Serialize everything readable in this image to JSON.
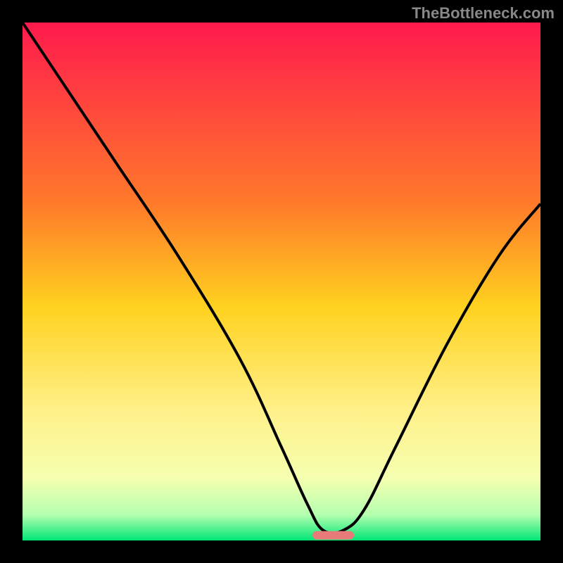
{
  "watermark": "TheBottleneck.com",
  "chart_data": {
    "type": "line",
    "title": "",
    "xlabel": "",
    "ylabel": "",
    "xlim": [
      0,
      100
    ],
    "ylim": [
      0,
      100
    ],
    "gradient_stops": [
      {
        "offset": 0,
        "color": "#ff1a4d"
      },
      {
        "offset": 35,
        "color": "#ff7a2a"
      },
      {
        "offset": 55,
        "color": "#ffd21f"
      },
      {
        "offset": 75,
        "color": "#fff08a"
      },
      {
        "offset": 88,
        "color": "#f5ffb0"
      },
      {
        "offset": 95,
        "color": "#b6ffb0"
      },
      {
        "offset": 100,
        "color": "#00e676"
      }
    ],
    "series": [
      {
        "name": "bottleneck-curve",
        "x": [
          0,
          8,
          18,
          30,
          42,
          50,
          55,
          58,
          62,
          66,
          72,
          82,
          92,
          100
        ],
        "values": [
          100,
          88,
          73,
          55,
          35,
          18,
          7,
          2,
          2,
          6,
          18,
          38,
          55,
          65
        ]
      }
    ],
    "optimum_marker": {
      "x_start": 56,
      "x_end": 64,
      "y": 1,
      "color": "#e87a7a"
    }
  }
}
